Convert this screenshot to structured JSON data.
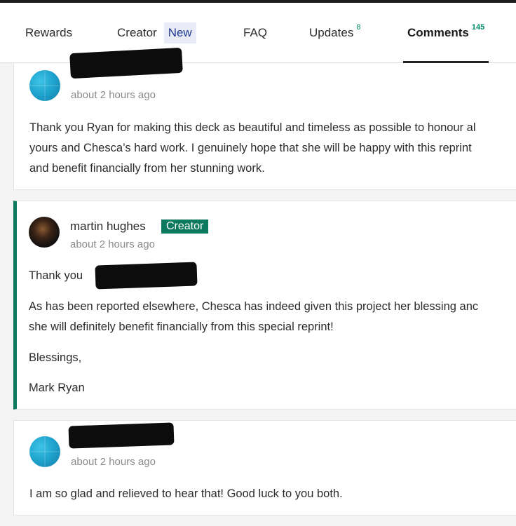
{
  "tabs": [
    {
      "label": "Rewards"
    },
    {
      "label": "Creator",
      "badge": "New"
    },
    {
      "label": "FAQ"
    },
    {
      "label": "Updates",
      "count": "8"
    },
    {
      "label": "Comments",
      "count": "145",
      "active": true
    }
  ],
  "comments": [
    {
      "time": "about 2 hours ago",
      "lines": [
        "Thank you Ryan for making this deck as beautiful and timeless as possible to honour al",
        "yours and Chesca’s hard work. I genuinely hope that she will be happy with this reprint",
        "and benefit financially from her stunning work."
      ]
    },
    {
      "author": "martin hughes",
      "badge": "Creator",
      "time": "about 2 hours ago",
      "greeting": "Thank you",
      "lines": [
        "As has been reported elsewhere, Chesca has indeed given this project her blessing anc",
        "she will definitely benefit financially from this special reprint!"
      ],
      "closing": "Blessings,",
      "signature": "Mark Ryan"
    },
    {
      "time": "about 2 hours ago",
      "lines": [
        "I am so glad and relieved to hear that! Good luck to you both."
      ]
    }
  ]
}
